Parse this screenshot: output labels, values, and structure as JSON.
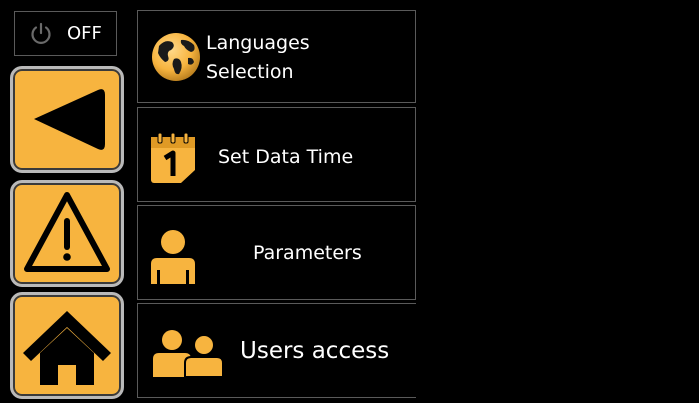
{
  "power": {
    "label": "OFF",
    "icon": "power-icon"
  },
  "nav": [
    {
      "icon": "back-arrow-icon"
    },
    {
      "icon": "warning-icon"
    },
    {
      "icon": "home-icon"
    }
  ],
  "menu": {
    "languages": {
      "line1": "Languages",
      "line2": "Selection",
      "icon": "globe-icon"
    },
    "datetime": {
      "label": "Set Data Time",
      "icon": "calendar-icon"
    },
    "parameters": {
      "label": "Parameters",
      "icon": "user-icon"
    },
    "users": {
      "label": "Users access",
      "icon": "users-icon"
    }
  },
  "colors": {
    "accent": "#f7b43f",
    "background": "#000000",
    "border": "#5a5a5a"
  }
}
